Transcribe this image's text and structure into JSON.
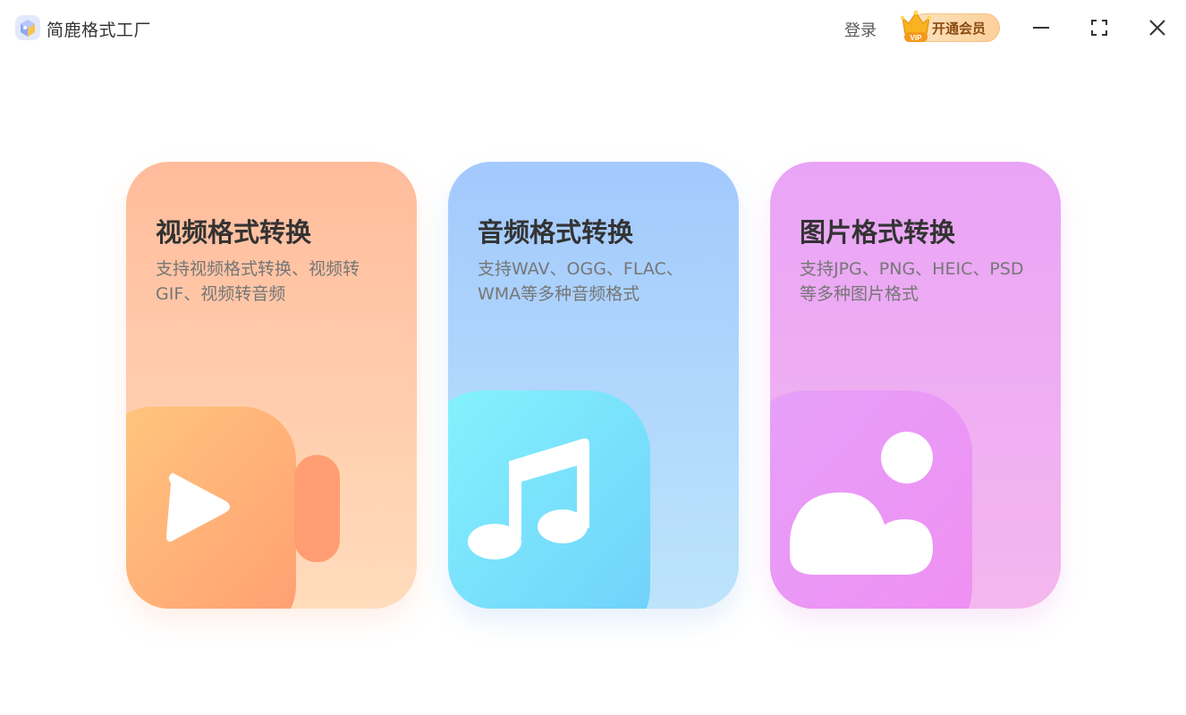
{
  "titlebar": {
    "app_title": "简鹿格式工厂",
    "login_label": "登录",
    "vip_label": "开通会员",
    "vip_badge": "VIP"
  },
  "cards": [
    {
      "title": "视频格式转换",
      "description": "支持视频格式转换、视频转GIF、视频转音频",
      "icon": "video-camera-icon",
      "color": "#ffbc9c"
    },
    {
      "title": "音频格式转换",
      "description": "支持WAV、OGG、FLAC、WMA等多种音频格式",
      "icon": "music-note-icon",
      "color": "#a3c9fd"
    },
    {
      "title": "图片格式转换",
      "description": "支持JPG、PNG、HEIC、PSD等多种图片格式",
      "icon": "image-icon",
      "color": "#e9a4f6"
    }
  ]
}
